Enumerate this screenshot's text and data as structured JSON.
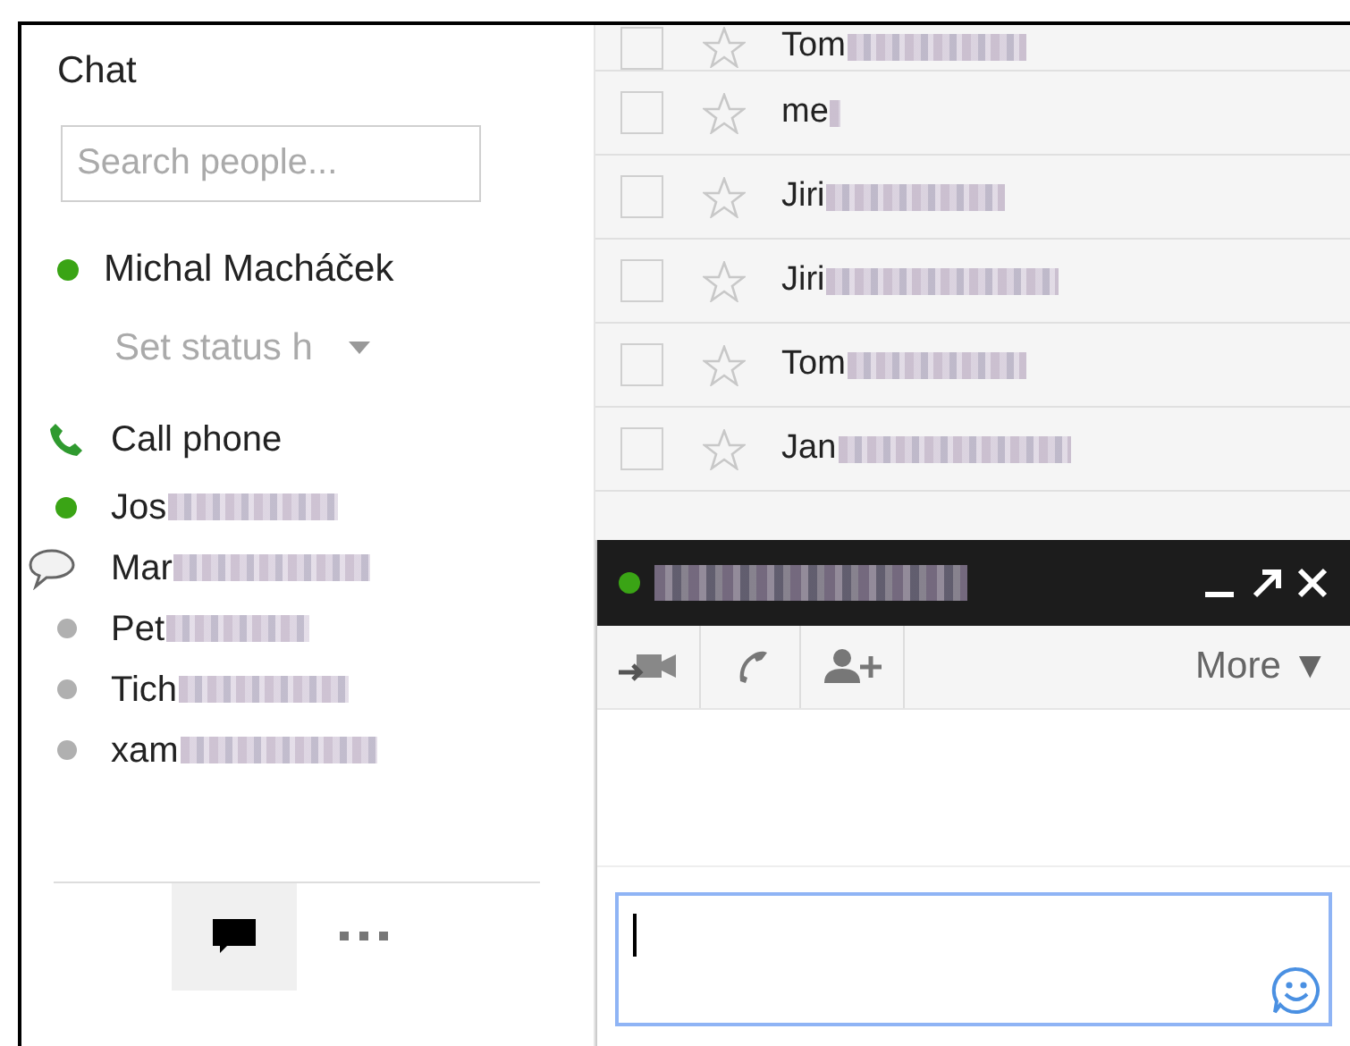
{
  "sidebar": {
    "title": "Chat",
    "search": {
      "placeholder": "Search people..."
    },
    "me": {
      "name": "Michal Macháček",
      "online": true,
      "status_message": "Set status h"
    },
    "contacts": [
      {
        "kind": "phone",
        "name": "Call phone",
        "redacted": false
      },
      {
        "kind": "online",
        "name": "Jos",
        "redacted": true
      },
      {
        "kind": "chatting",
        "name": "Mar",
        "redacted": true
      },
      {
        "kind": "offline",
        "name": "Pet",
        "redacted": true
      },
      {
        "kind": "offline",
        "name": "Tich",
        "redacted": true
      },
      {
        "kind": "offline",
        "name": "xam",
        "redacted": true
      }
    ],
    "bottom_tabs": [
      {
        "kind": "chat",
        "selected": true
      },
      {
        "kind": "more",
        "selected": false
      }
    ]
  },
  "mail_list": {
    "rows": [
      {
        "sender": "Tom",
        "checked": false,
        "starred": false,
        "redacted": true
      },
      {
        "sender": "me",
        "checked": false,
        "starred": false,
        "redacted": true
      },
      {
        "sender": "Jiri",
        "checked": false,
        "starred": false,
        "redacted": true
      },
      {
        "sender": "Jiri",
        "checked": false,
        "starred": false,
        "redacted": true
      },
      {
        "sender": "Tom",
        "checked": false,
        "starred": false,
        "redacted": true
      },
      {
        "sender": "Jan",
        "checked": false,
        "starred": false,
        "redacted": true
      }
    ]
  },
  "chat_window": {
    "online": true,
    "name_redacted": true,
    "toolbar_more": "More ▼",
    "input": {
      "focused": true
    }
  }
}
